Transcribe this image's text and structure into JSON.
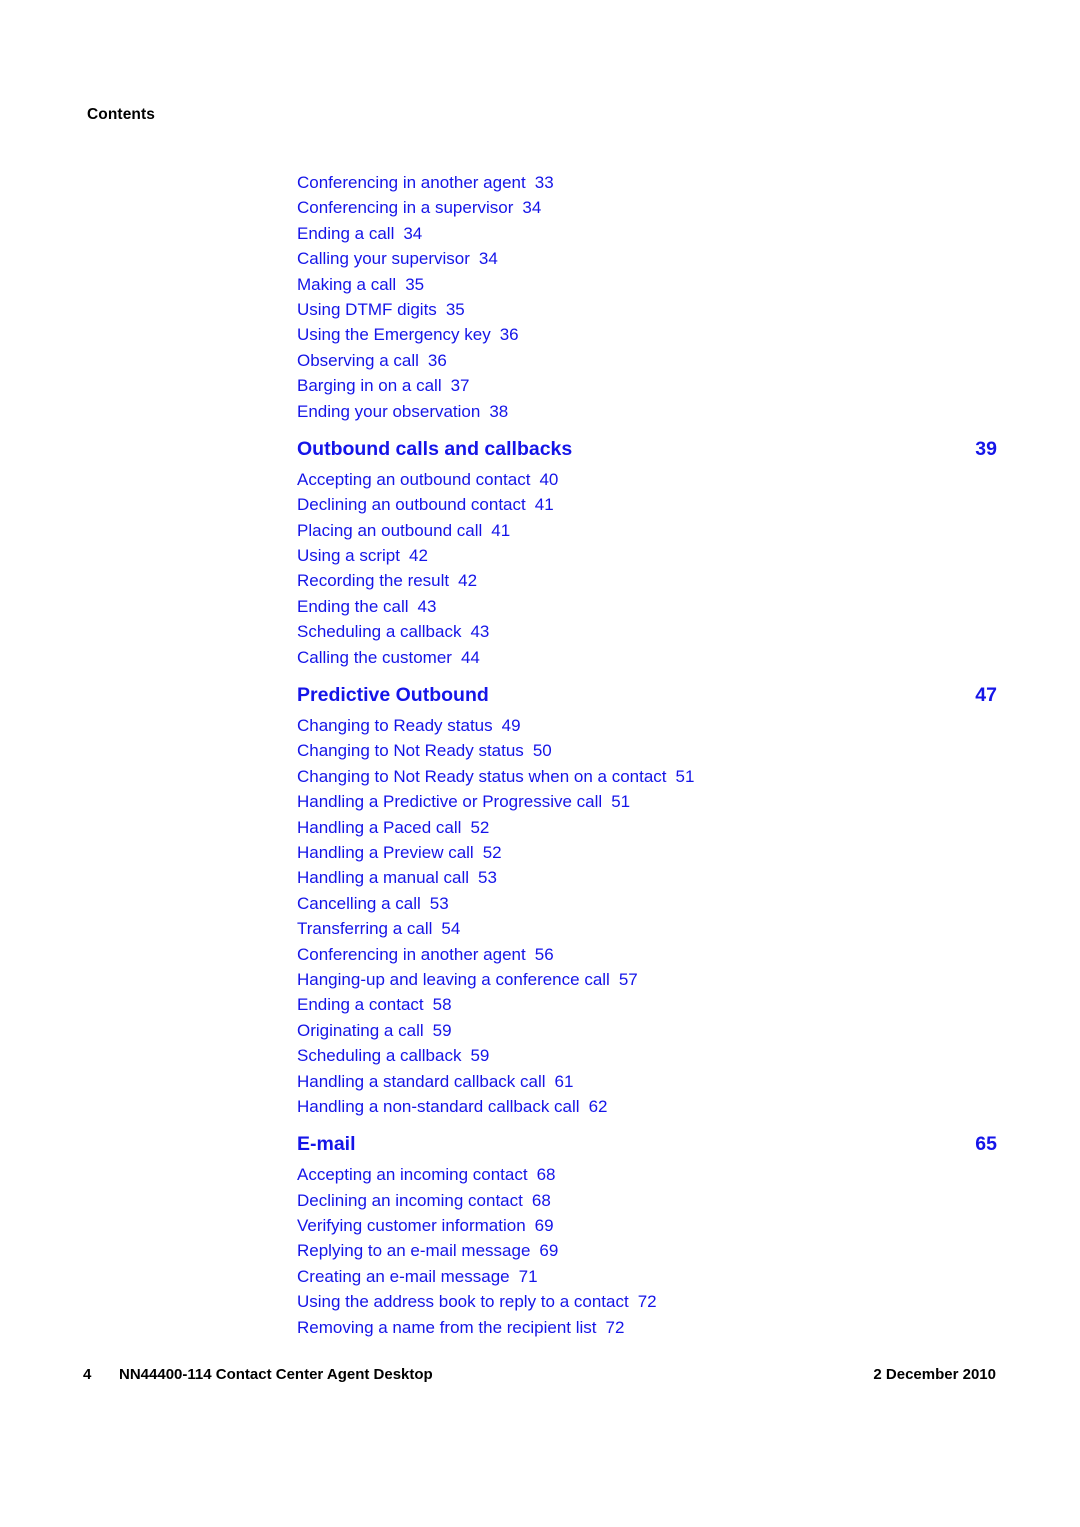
{
  "document": {
    "running_header": "Contents"
  },
  "toc": {
    "entries": [
      {
        "kind": "entry",
        "label": "Conferencing in another agent",
        "page": "33"
      },
      {
        "kind": "entry",
        "label": "Conferencing in a supervisor",
        "page": "34"
      },
      {
        "kind": "entry",
        "label": "Ending a call",
        "page": "34"
      },
      {
        "kind": "entry",
        "label": "Calling your supervisor",
        "page": "34"
      },
      {
        "kind": "entry",
        "label": "Making a call",
        "page": "35"
      },
      {
        "kind": "entry",
        "label": "Using DTMF digits",
        "page": "35"
      },
      {
        "kind": "entry",
        "label": "Using the Emergency key",
        "page": "36"
      },
      {
        "kind": "entry",
        "label": "Observing a call",
        "page": "36"
      },
      {
        "kind": "entry",
        "label": "Barging in on a call",
        "page": "37"
      },
      {
        "kind": "entry",
        "label": "Ending your observation",
        "page": "38"
      },
      {
        "kind": "heading",
        "label": "Outbound calls and callbacks",
        "page": "39"
      },
      {
        "kind": "entry",
        "label": "Accepting an outbound contact",
        "page": "40"
      },
      {
        "kind": "entry",
        "label": "Declining an outbound contact",
        "page": "41"
      },
      {
        "kind": "entry",
        "label": "Placing an outbound call",
        "page": "41"
      },
      {
        "kind": "entry",
        "label": "Using a script",
        "page": "42"
      },
      {
        "kind": "entry",
        "label": "Recording the result",
        "page": "42"
      },
      {
        "kind": "entry",
        "label": "Ending the call",
        "page": "43"
      },
      {
        "kind": "entry",
        "label": "Scheduling a callback",
        "page": "43"
      },
      {
        "kind": "entry",
        "label": "Calling the customer",
        "page": "44"
      },
      {
        "kind": "heading",
        "label": "Predictive Outbound",
        "page": "47"
      },
      {
        "kind": "entry",
        "label": "Changing to Ready status",
        "page": "49"
      },
      {
        "kind": "entry",
        "label": "Changing to Not Ready status",
        "page": "50"
      },
      {
        "kind": "entry",
        "label": "Changing to Not Ready status when on a contact",
        "page": "51"
      },
      {
        "kind": "entry",
        "label": "Handling a Predictive or Progressive call",
        "page": "51"
      },
      {
        "kind": "entry",
        "label": "Handling a Paced call",
        "page": "52"
      },
      {
        "kind": "entry",
        "label": "Handling a Preview call",
        "page": "52"
      },
      {
        "kind": "entry",
        "label": "Handling a manual call",
        "page": "53"
      },
      {
        "kind": "entry",
        "label": "Cancelling a call",
        "page": "53"
      },
      {
        "kind": "entry",
        "label": "Transferring a call",
        "page": "54"
      },
      {
        "kind": "entry",
        "label": "Conferencing in another agent",
        "page": "56"
      },
      {
        "kind": "entry",
        "label": "Hanging-up and leaving a conference call",
        "page": "57"
      },
      {
        "kind": "entry",
        "label": "Ending a contact",
        "page": "58"
      },
      {
        "kind": "entry",
        "label": "Originating a call",
        "page": "59"
      },
      {
        "kind": "entry",
        "label": "Scheduling a callback",
        "page": "59"
      },
      {
        "kind": "entry",
        "label": "Handling a standard callback call",
        "page": "61"
      },
      {
        "kind": "entry",
        "label": "Handling a non-standard callback call",
        "page": "62"
      },
      {
        "kind": "heading",
        "label": "E-mail",
        "page": "65"
      },
      {
        "kind": "entry",
        "label": "Accepting an incoming contact",
        "page": "68"
      },
      {
        "kind": "entry",
        "label": "Declining an incoming contact",
        "page": "68"
      },
      {
        "kind": "entry",
        "label": "Verifying customer information",
        "page": "69"
      },
      {
        "kind": "entry",
        "label": "Replying to an e-mail message",
        "page": "69"
      },
      {
        "kind": "entry",
        "label": "Creating an e-mail message",
        "page": "71"
      },
      {
        "kind": "entry",
        "label": "Using the address book to reply to a contact",
        "page": "72"
      },
      {
        "kind": "entry",
        "label": "Removing a name from the recipient list",
        "page": "72"
      }
    ]
  },
  "footer": {
    "folio": "4",
    "document_title": "NN44400-114 Contact Center Agent Desktop",
    "date": "2 December 2010"
  },
  "colors": {
    "link_blue": "#1515e8",
    "body_text": "#000000",
    "page_background": "#ffffff"
  }
}
